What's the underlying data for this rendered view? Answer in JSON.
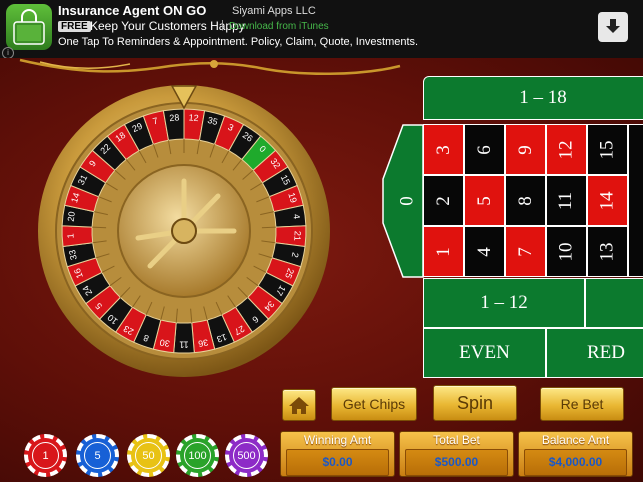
{
  "ad": {
    "title": "Insurance Agent ON GO",
    "developer": "Siyami Apps LLC",
    "free_badge": "FREE",
    "tagline": "Keep Your Customers Happy",
    "separator": "|",
    "download_link": "Download from iTunes",
    "description": "One Tap To Reminders & Appointment. Policy, Claim, Quote, Investments.",
    "info_glyph": "i"
  },
  "wheel": {
    "numbers": [
      "0",
      "32",
      "15",
      "19",
      "4",
      "21",
      "2",
      "25",
      "17",
      "34",
      "6",
      "27",
      "13",
      "36",
      "11",
      "30",
      "8",
      "23",
      "10",
      "5",
      "24",
      "16",
      "33",
      "1",
      "20",
      "14",
      "31",
      "9",
      "22",
      "18",
      "29",
      "7",
      "28",
      "12",
      "35",
      "3",
      "26"
    ]
  },
  "table": {
    "zero": "0",
    "columns": [
      [
        "3",
        "2",
        "1"
      ],
      [
        "6",
        "5",
        "4"
      ],
      [
        "9",
        "8",
        "7"
      ],
      [
        "12",
        "11",
        "10"
      ],
      [
        "15",
        "14",
        "13"
      ]
    ],
    "colors": {
      "1": "red",
      "2": "black",
      "3": "red",
      "4": "black",
      "5": "red",
      "6": "black",
      "7": "red",
      "8": "black",
      "9": "red",
      "10": "black",
      "11": "black",
      "12": "red",
      "13": "black",
      "14": "red",
      "15": "black"
    },
    "top_bet": "1 – 18",
    "dozen_bet": "1 – 12",
    "even_bet": "EVEN",
    "red_bet": "RED"
  },
  "controls": {
    "home_icon": "home-icon",
    "get_chips": "Get Chips",
    "spin": "Spin",
    "re_bet": "Re Bet"
  },
  "chips": [
    {
      "value": "1",
      "color": "#d8161a"
    },
    {
      "value": "5",
      "color": "#1760d6"
    },
    {
      "value": "50",
      "color": "#e8c214"
    },
    {
      "value": "100",
      "color": "#2aa32a"
    },
    {
      "value": "500",
      "color": "#8d2bc7"
    }
  ],
  "stats": {
    "winning_label": "Winning Amt",
    "winning_value": "$0.00",
    "total_label": "Total Bet",
    "total_value": "$500.00",
    "balance_label": "Balance Amt",
    "balance_value": "$4,000.00"
  }
}
